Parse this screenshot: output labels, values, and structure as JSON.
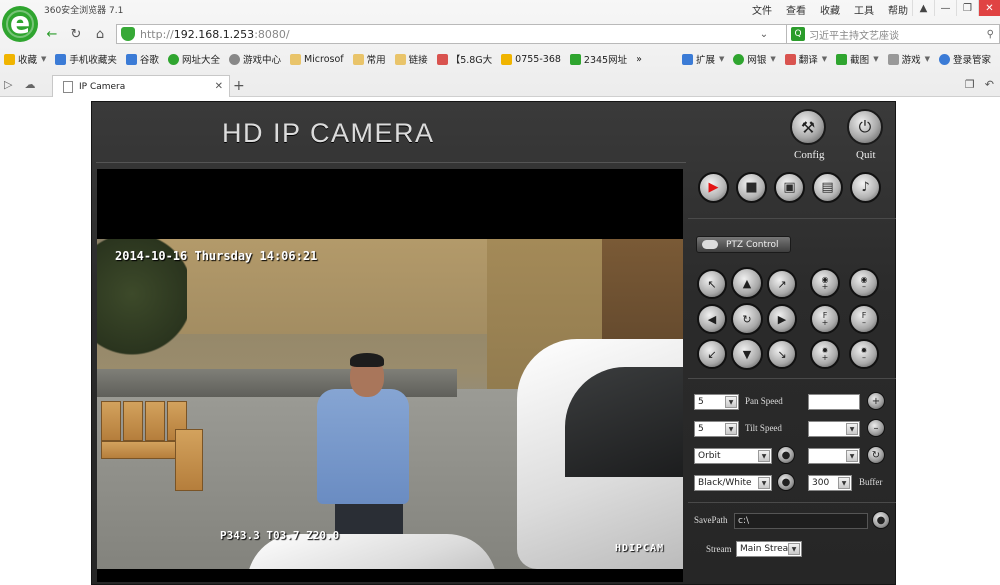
{
  "browser": {
    "app_title": "360安全浏览器 7.1",
    "menu": [
      "文件",
      "查看",
      "收藏",
      "工具",
      "帮助"
    ],
    "url": {
      "scheme": "http://",
      "host": "192.168.1.253",
      "port": ":8080/"
    },
    "search_text": "习近平主持文艺座谈",
    "bookmarks": [
      "收藏",
      "手机收藏夹",
      "谷歌",
      "网址大全",
      "游戏中心",
      "Microsof",
      "常用",
      "链接",
      "【5.8G大",
      "0755-368",
      "2345网址"
    ],
    "bookmarks_right": [
      "扩展",
      "网银",
      "翻译",
      "截图",
      "游戏",
      "登录管家"
    ],
    "tab_title": "IP Camera",
    "accent": "#2fa52f"
  },
  "camera": {
    "brand": "HD IP CAMERA",
    "config_label": "Config",
    "quit_label": "Quit",
    "osd_datetime": "2014-10-16 Thursday 14:06:21",
    "osd_ptz": "P343.3 T03.7 Z20.0",
    "osd_brand": "HDIPCAM",
    "ptz_control_label": "PTZ Control",
    "pan_speed": {
      "value": "5",
      "label": "Pan Speed"
    },
    "tilt_speed": {
      "value": "5",
      "label": "Tilt Speed"
    },
    "cruise_mode": "Orbit",
    "color_mode": "Black/White",
    "buffer": {
      "value": "300",
      "label": "Buffer"
    },
    "save_path": {
      "label": "SavePath",
      "value": "c:\\"
    },
    "stream": {
      "label": "Stream",
      "value": "Main Strea"
    },
    "ptz_icons": {
      "focus_plus": "F",
      "focus_minus": "F"
    }
  }
}
